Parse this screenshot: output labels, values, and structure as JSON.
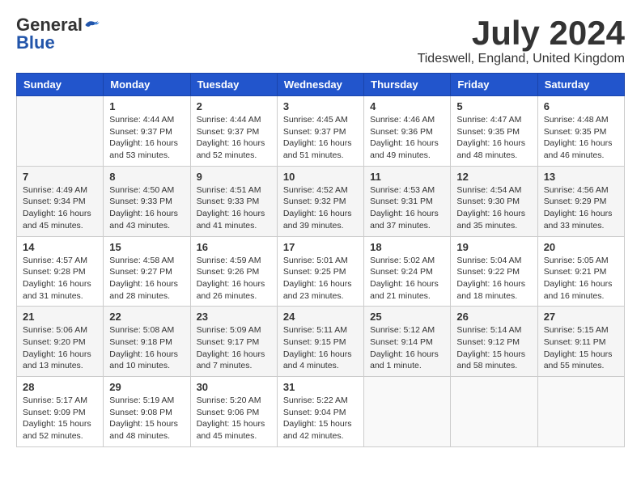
{
  "header": {
    "logo_general": "General",
    "logo_blue": "Blue",
    "month_year": "July 2024",
    "location": "Tideswell, England, United Kingdom"
  },
  "days_of_week": [
    "Sunday",
    "Monday",
    "Tuesday",
    "Wednesday",
    "Thursday",
    "Friday",
    "Saturday"
  ],
  "weeks": [
    [
      {
        "day": "",
        "content": ""
      },
      {
        "day": "1",
        "content": "Sunrise: 4:44 AM\nSunset: 9:37 PM\nDaylight: 16 hours\nand 53 minutes."
      },
      {
        "day": "2",
        "content": "Sunrise: 4:44 AM\nSunset: 9:37 PM\nDaylight: 16 hours\nand 52 minutes."
      },
      {
        "day": "3",
        "content": "Sunrise: 4:45 AM\nSunset: 9:37 PM\nDaylight: 16 hours\nand 51 minutes."
      },
      {
        "day": "4",
        "content": "Sunrise: 4:46 AM\nSunset: 9:36 PM\nDaylight: 16 hours\nand 49 minutes."
      },
      {
        "day": "5",
        "content": "Sunrise: 4:47 AM\nSunset: 9:35 PM\nDaylight: 16 hours\nand 48 minutes."
      },
      {
        "day": "6",
        "content": "Sunrise: 4:48 AM\nSunset: 9:35 PM\nDaylight: 16 hours\nand 46 minutes."
      }
    ],
    [
      {
        "day": "7",
        "content": "Sunrise: 4:49 AM\nSunset: 9:34 PM\nDaylight: 16 hours\nand 45 minutes."
      },
      {
        "day": "8",
        "content": "Sunrise: 4:50 AM\nSunset: 9:33 PM\nDaylight: 16 hours\nand 43 minutes."
      },
      {
        "day": "9",
        "content": "Sunrise: 4:51 AM\nSunset: 9:33 PM\nDaylight: 16 hours\nand 41 minutes."
      },
      {
        "day": "10",
        "content": "Sunrise: 4:52 AM\nSunset: 9:32 PM\nDaylight: 16 hours\nand 39 minutes."
      },
      {
        "day": "11",
        "content": "Sunrise: 4:53 AM\nSunset: 9:31 PM\nDaylight: 16 hours\nand 37 minutes."
      },
      {
        "day": "12",
        "content": "Sunrise: 4:54 AM\nSunset: 9:30 PM\nDaylight: 16 hours\nand 35 minutes."
      },
      {
        "day": "13",
        "content": "Sunrise: 4:56 AM\nSunset: 9:29 PM\nDaylight: 16 hours\nand 33 minutes."
      }
    ],
    [
      {
        "day": "14",
        "content": "Sunrise: 4:57 AM\nSunset: 9:28 PM\nDaylight: 16 hours\nand 31 minutes."
      },
      {
        "day": "15",
        "content": "Sunrise: 4:58 AM\nSunset: 9:27 PM\nDaylight: 16 hours\nand 28 minutes."
      },
      {
        "day": "16",
        "content": "Sunrise: 4:59 AM\nSunset: 9:26 PM\nDaylight: 16 hours\nand 26 minutes."
      },
      {
        "day": "17",
        "content": "Sunrise: 5:01 AM\nSunset: 9:25 PM\nDaylight: 16 hours\nand 23 minutes."
      },
      {
        "day": "18",
        "content": "Sunrise: 5:02 AM\nSunset: 9:24 PM\nDaylight: 16 hours\nand 21 minutes."
      },
      {
        "day": "19",
        "content": "Sunrise: 5:04 AM\nSunset: 9:22 PM\nDaylight: 16 hours\nand 18 minutes."
      },
      {
        "day": "20",
        "content": "Sunrise: 5:05 AM\nSunset: 9:21 PM\nDaylight: 16 hours\nand 16 minutes."
      }
    ],
    [
      {
        "day": "21",
        "content": "Sunrise: 5:06 AM\nSunset: 9:20 PM\nDaylight: 16 hours\nand 13 minutes."
      },
      {
        "day": "22",
        "content": "Sunrise: 5:08 AM\nSunset: 9:18 PM\nDaylight: 16 hours\nand 10 minutes."
      },
      {
        "day": "23",
        "content": "Sunrise: 5:09 AM\nSunset: 9:17 PM\nDaylight: 16 hours\nand 7 minutes."
      },
      {
        "day": "24",
        "content": "Sunrise: 5:11 AM\nSunset: 9:15 PM\nDaylight: 16 hours\nand 4 minutes."
      },
      {
        "day": "25",
        "content": "Sunrise: 5:12 AM\nSunset: 9:14 PM\nDaylight: 16 hours\nand 1 minute."
      },
      {
        "day": "26",
        "content": "Sunrise: 5:14 AM\nSunset: 9:12 PM\nDaylight: 15 hours\nand 58 minutes."
      },
      {
        "day": "27",
        "content": "Sunrise: 5:15 AM\nSunset: 9:11 PM\nDaylight: 15 hours\nand 55 minutes."
      }
    ],
    [
      {
        "day": "28",
        "content": "Sunrise: 5:17 AM\nSunset: 9:09 PM\nDaylight: 15 hours\nand 52 minutes."
      },
      {
        "day": "29",
        "content": "Sunrise: 5:19 AM\nSunset: 9:08 PM\nDaylight: 15 hours\nand 48 minutes."
      },
      {
        "day": "30",
        "content": "Sunrise: 5:20 AM\nSunset: 9:06 PM\nDaylight: 15 hours\nand 45 minutes."
      },
      {
        "day": "31",
        "content": "Sunrise: 5:22 AM\nSunset: 9:04 PM\nDaylight: 15 hours\nand 42 minutes."
      },
      {
        "day": "",
        "content": ""
      },
      {
        "day": "",
        "content": ""
      },
      {
        "day": "",
        "content": ""
      }
    ]
  ]
}
